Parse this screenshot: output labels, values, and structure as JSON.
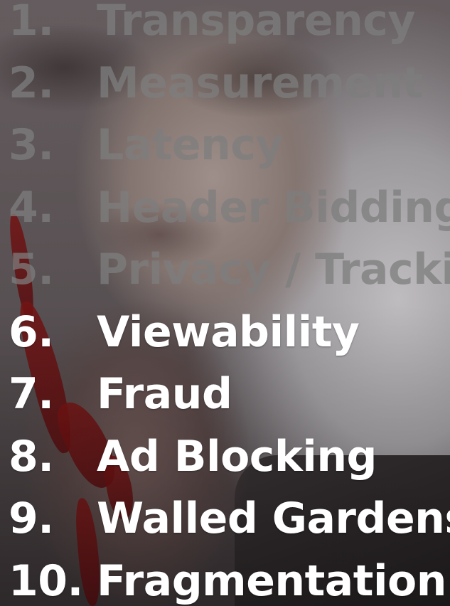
{
  "slide": {
    "items": [
      {
        "number": "1.",
        "label": "Transparency",
        "state": "faded"
      },
      {
        "number": "2.",
        "label": "Measurement",
        "state": "faded"
      },
      {
        "number": "3.",
        "label": "Latency",
        "state": "faded"
      },
      {
        "number": "4.",
        "label": "Header Bidding",
        "state": "faded"
      },
      {
        "number": "5.",
        "label": "Privacy / Tracking",
        "state": "faded"
      },
      {
        "number": "6.",
        "label": "Viewability",
        "state": "active"
      },
      {
        "number": "7.",
        "label": "Fraud",
        "state": "active"
      },
      {
        "number": "8.",
        "label": "Ad Blocking",
        "state": "active"
      },
      {
        "number": "9.",
        "label": "Walled Gardens",
        "state": "active"
      },
      {
        "number": "10.",
        "label": "Fragmentation",
        "state": "active"
      }
    ]
  },
  "colors": {
    "active_text": "#ffffff",
    "faded_text": "#7d7d7d",
    "blood": "#7a1414"
  }
}
